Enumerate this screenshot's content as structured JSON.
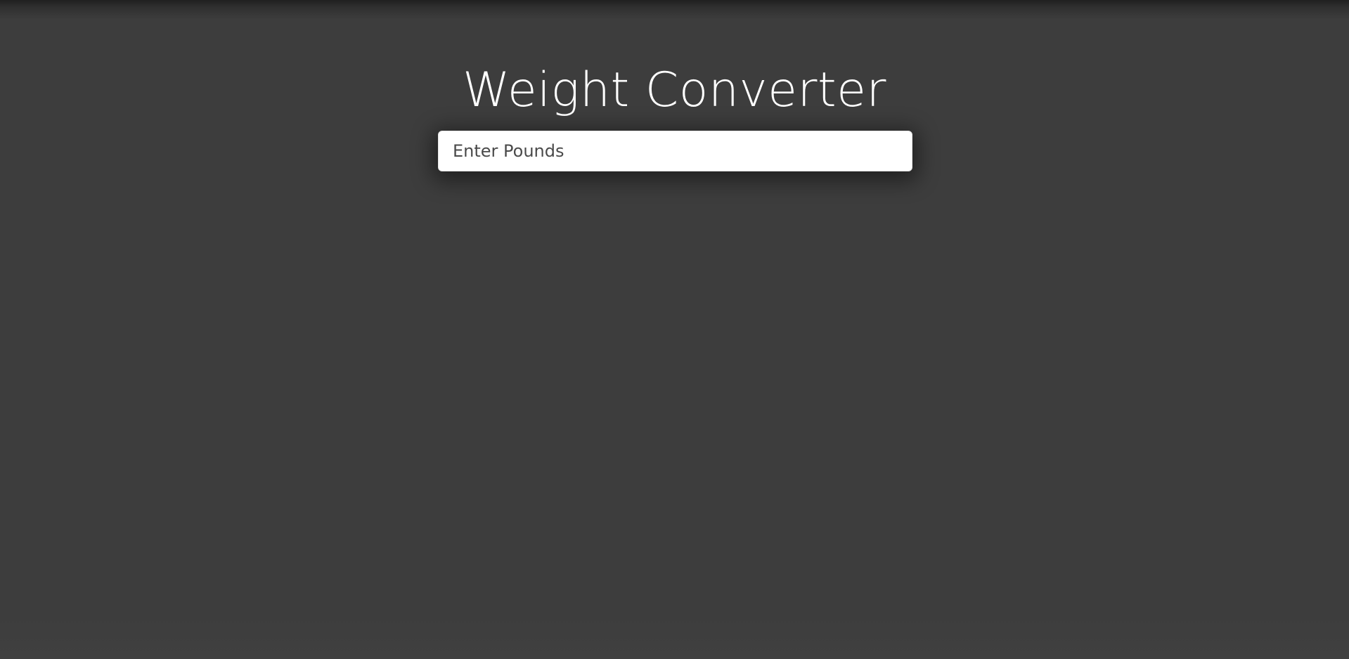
{
  "app": {
    "title": "Weight Converter"
  },
  "pounds_input": {
    "placeholder": "Enter Pounds",
    "value": ""
  },
  "colors": {
    "background": "#3d3d3d",
    "title_text": "#ffffff",
    "input_background": "#ffffff",
    "placeholder_text": "#4a4a4a"
  }
}
